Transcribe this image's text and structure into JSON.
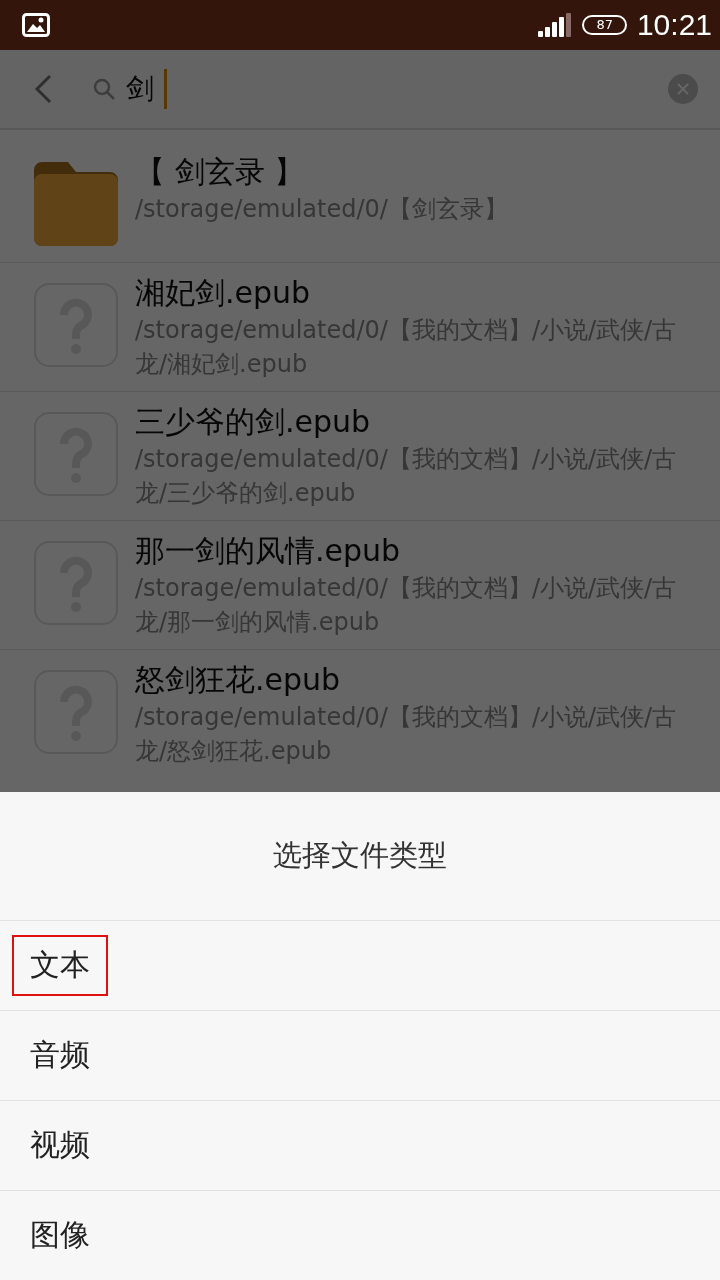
{
  "status_bar": {
    "time": "10:21",
    "battery": "87"
  },
  "search": {
    "value": "剑"
  },
  "results": [
    {
      "kind": "folder",
      "name": "【 剑玄录 】",
      "path": "/storage/emulated/0/【剑玄录】"
    },
    {
      "kind": "unknown",
      "name": "湘妃剑.epub",
      "path": "/storage/emulated/0/【我的文档】/小说/武侠/古龙/湘妃剑.epub"
    },
    {
      "kind": "unknown",
      "name": "三少爷的剑.epub",
      "path": "/storage/emulated/0/【我的文档】/小说/武侠/古龙/三少爷的剑.epub"
    },
    {
      "kind": "unknown",
      "name": "那一剑的风情.epub",
      "path": "/storage/emulated/0/【我的文档】/小说/武侠/古龙/那一剑的风情.epub"
    },
    {
      "kind": "unknown",
      "name": "怒剑狂花.epub",
      "path": "/storage/emulated/0/【我的文档】/小说/武侠/古龙/怒剑狂花.epub"
    }
  ],
  "sheet": {
    "title": "选择文件类型",
    "options": [
      {
        "label": "文本",
        "highlighted": true
      },
      {
        "label": "音频",
        "highlighted": false
      },
      {
        "label": "视频",
        "highlighted": false
      },
      {
        "label": "图像",
        "highlighted": false
      }
    ]
  }
}
